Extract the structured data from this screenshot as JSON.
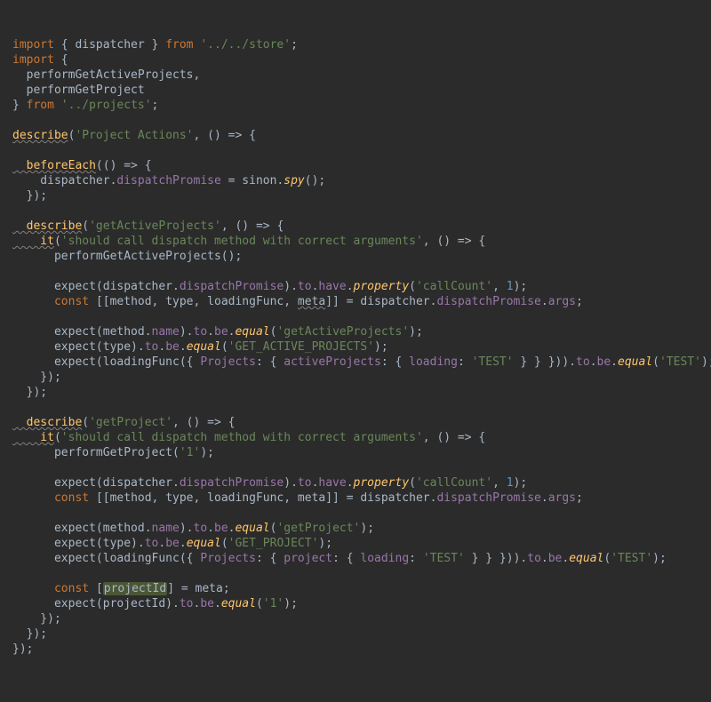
{
  "code": {
    "l01_a": "import",
    "l01_b": " { dispatcher } ",
    "l01_c": "from ",
    "l01_d": "'../../store'",
    "l01_e": ";",
    "l02_a": "import",
    "l02_b": " {",
    "l03": "  performGetActiveProjects,",
    "l04": "  performGetProject",
    "l05_a": "} ",
    "l05_b": "from ",
    "l05_c": "'../projects'",
    "l05_d": ";",
    "l06": "",
    "l07_a": "describe",
    "l07_b": "(",
    "l07_c": "'Project Actions'",
    "l07_d": ", () => {",
    "l08": "",
    "l09_a": "  beforeEach",
    "l09_b": "(() => {",
    "l10_a": "    dispatcher.",
    "l10_b": "dispatchPromise",
    "l10_c": " = sinon.",
    "l10_d": "spy",
    "l10_e": "();",
    "l11": "  });",
    "l12": "",
    "l13_a": "  describe",
    "l13_b": "(",
    "l13_c": "'getActiveProjects'",
    "l13_d": ", () => {",
    "l14_a": "    it",
    "l14_b": "(",
    "l14_c": "'should call dispatch method with correct arguments'",
    "l14_d": ", () => {",
    "l15": "      performGetActiveProjects();",
    "l16": "",
    "l17_a": "      expect(dispatcher.",
    "l17_b": "dispatchPromise",
    "l17_c": ").",
    "l17_d": "to",
    "l17_e": ".",
    "l17_f": "have",
    "l17_g": ".",
    "l17_h": "property",
    "l17_i": "(",
    "l17_j": "'callCount'",
    "l17_k": ", ",
    "l17_l": "1",
    "l17_m": ");",
    "l18_a": "      ",
    "l18_b": "const ",
    "l18_c": "[[method, type, loadingFunc, ",
    "l18_d": "meta",
    "l18_e": "]] = dispatcher.",
    "l18_f": "dispatchPromise",
    "l18_g": ".",
    "l18_h": "args",
    "l18_i": ";",
    "l19": "",
    "l20_a": "      expect(method.",
    "l20_b": "name",
    "l20_c": ").",
    "l20_d": "to",
    "l20_e": ".",
    "l20_f": "be",
    "l20_g": ".",
    "l20_h": "equal",
    "l20_i": "(",
    "l20_j": "'getActiveProjects'",
    "l20_k": ");",
    "l21_a": "      expect(type).",
    "l21_b": "to",
    "l21_c": ".",
    "l21_d": "be",
    "l21_e": ".",
    "l21_f": "equal",
    "l21_g": "(",
    "l21_h": "'GET_ACTIVE_PROJECTS'",
    "l21_i": ");",
    "l22_a": "      expect(loadingFunc({ ",
    "l22_b": "Projects",
    "l22_c": ": { ",
    "l22_d": "activeProjects",
    "l22_e": ": { ",
    "l22_f": "loading",
    "l22_g": ": ",
    "l22_h": "'TEST'",
    "l22_i": " } } })).",
    "l22_j": "to",
    "l22_k": ".",
    "l22_l": "be",
    "l22_m": ".",
    "l22_n": "equal",
    "l22_o": "(",
    "l22_p": "'TEST'",
    "l22_q": ");",
    "l23": "    });",
    "l24": "  });",
    "l25": "",
    "l26_a": "  describe",
    "l26_b": "(",
    "l26_c": "'getProject'",
    "l26_d": ", () => {",
    "l27_a": "    it",
    "l27_b": "(",
    "l27_c": "'should call dispatch method with correct arguments'",
    "l27_d": ", () => {",
    "l28_a": "      performGetProject(",
    "l28_b": "'1'",
    "l28_c": ");",
    "l29": "",
    "l30_a": "      expect(dispatcher.",
    "l30_b": "dispatchPromise",
    "l30_c": ").",
    "l30_d": "to",
    "l30_e": ".",
    "l30_f": "have",
    "l30_g": ".",
    "l30_h": "property",
    "l30_i": "(",
    "l30_j": "'callCount'",
    "l30_k": ", ",
    "l30_l": "1",
    "l30_m": ");",
    "l31_a": "      ",
    "l31_b": "const ",
    "l31_c": "[[method, type, loadingFunc, meta]] = dispatcher.",
    "l31_d": "dispatchPromise",
    "l31_e": ".",
    "l31_f": "args",
    "l31_g": ";",
    "l32": "",
    "l33_a": "      expect(method.",
    "l33_b": "name",
    "l33_c": ").",
    "l33_d": "to",
    "l33_e": ".",
    "l33_f": "be",
    "l33_g": ".",
    "l33_h": "equal",
    "l33_i": "(",
    "l33_j": "'getProject'",
    "l33_k": ");",
    "l34_a": "      expect(type).",
    "l34_b": "to",
    "l34_c": ".",
    "l34_d": "be",
    "l34_e": ".",
    "l34_f": "equal",
    "l34_g": "(",
    "l34_h": "'GET_PROJECT'",
    "l34_i": ");",
    "l35_a": "      expect(loadingFunc({ ",
    "l35_b": "Projects",
    "l35_c": ": { ",
    "l35_d": "project",
    "l35_e": ": { ",
    "l35_f": "loading",
    "l35_g": ": ",
    "l35_h": "'TEST'",
    "l35_i": " } } })).",
    "l35_j": "to",
    "l35_k": ".",
    "l35_l": "be",
    "l35_m": ".",
    "l35_n": "equal",
    "l35_o": "(",
    "l35_p": "'TEST'",
    "l35_q": ");",
    "l36": "",
    "l37_a": "      ",
    "l37_b": "const ",
    "l37_c": "[",
    "l37_d": "projectId",
    "l37_e": "] = meta;",
    "l38_a": "      expect(projectId).",
    "l38_b": "to",
    "l38_c": ".",
    "l38_d": "be",
    "l38_e": ".",
    "l38_f": "equal",
    "l38_g": "(",
    "l38_h": "'1'",
    "l38_i": ");",
    "l39": "    });",
    "l40": "  });",
    "l41": "});"
  }
}
